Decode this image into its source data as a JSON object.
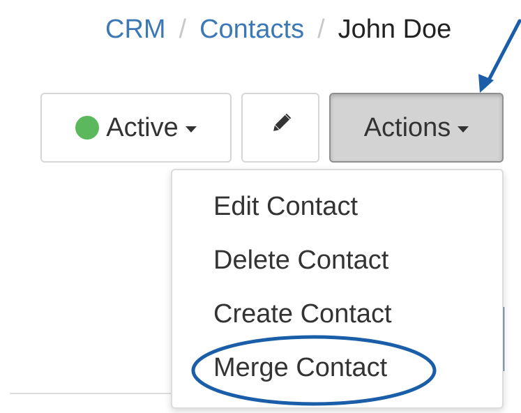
{
  "breadcrumb": {
    "items": [
      "CRM",
      "Contacts"
    ],
    "separator": "/",
    "current": "John Doe"
  },
  "toolbar": {
    "status_label": "Active",
    "status_color": "#5cb85c",
    "edit_icon": "pencil-icon",
    "actions_label": "Actions"
  },
  "actions_menu": {
    "items": [
      "Edit Contact",
      "Delete Contact",
      "Create Contact",
      "Merge Contact"
    ],
    "highlighted": "Merge Contact"
  },
  "annotation": {
    "color": "#1a5da8",
    "shapes": [
      "arrow pointing to Actions button",
      "ellipse circling Merge Contact"
    ]
  }
}
